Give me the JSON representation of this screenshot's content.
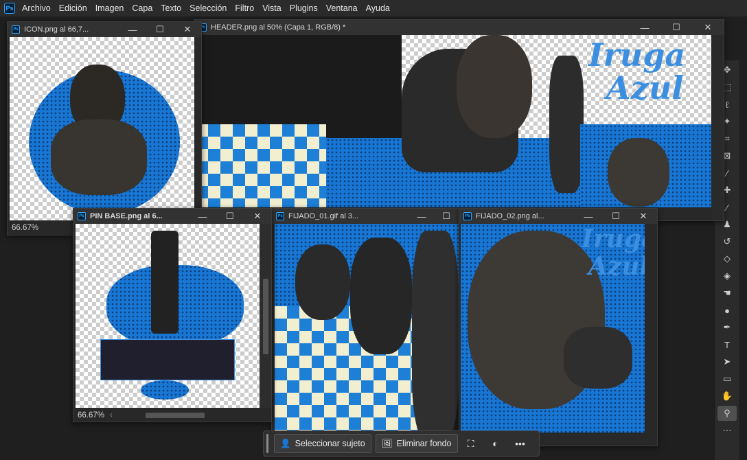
{
  "menubar": {
    "app_logo": "Ps",
    "items": [
      "Archivo",
      "Edición",
      "Imagen",
      "Capa",
      "Texto",
      "Selección",
      "Filtro",
      "Vista",
      "Plugins",
      "Ventana",
      "Ayuda"
    ]
  },
  "windows": {
    "icon": {
      "title": "ICON.png al 66,7...",
      "zoom": "66.67%"
    },
    "header": {
      "title": "HEADER.png al 50% (Capa 1, RGB/8) *"
    },
    "pin_base": {
      "title": "PIN BASE.png al 6...",
      "zoom": "66.67%"
    },
    "fijado_01": {
      "title": "FIJADO_01.gif al 3..."
    },
    "fijado_02": {
      "title": "FIJADO_02.png al..."
    }
  },
  "image_text": {
    "header_word1": "Iruga",
    "header_word2": "Azul",
    "fijado_word1": "Iruga",
    "fijado_word2": "Azul"
  },
  "window_controls": {
    "minimize": "—",
    "maximize": "☐",
    "close": "✕"
  },
  "toolbar": {
    "tools": [
      "move-tool",
      "artboard-tool",
      "lasso-tool",
      "magic-wand-tool",
      "crop-tool",
      "frame-tool",
      "eyedropper-tool",
      "healing-brush-tool",
      "brush-tool",
      "clone-stamp-tool",
      "history-brush-tool",
      "eraser-tool",
      "paint-bucket-tool",
      "smudge-tool",
      "dodge-tool",
      "pen-tool",
      "type-tool",
      "path-selection-tool",
      "rectangle-tool",
      "hand-tool",
      "zoom-tool",
      "more-tools"
    ],
    "active": "zoom-tool"
  },
  "context_bar": {
    "select_subject": "Seleccionar sujeto",
    "remove_background": "Eliminar fondo"
  },
  "colors": {
    "accent": "#31a8ff",
    "image_blue": "#1877d4",
    "cream": "#f2eed0"
  }
}
